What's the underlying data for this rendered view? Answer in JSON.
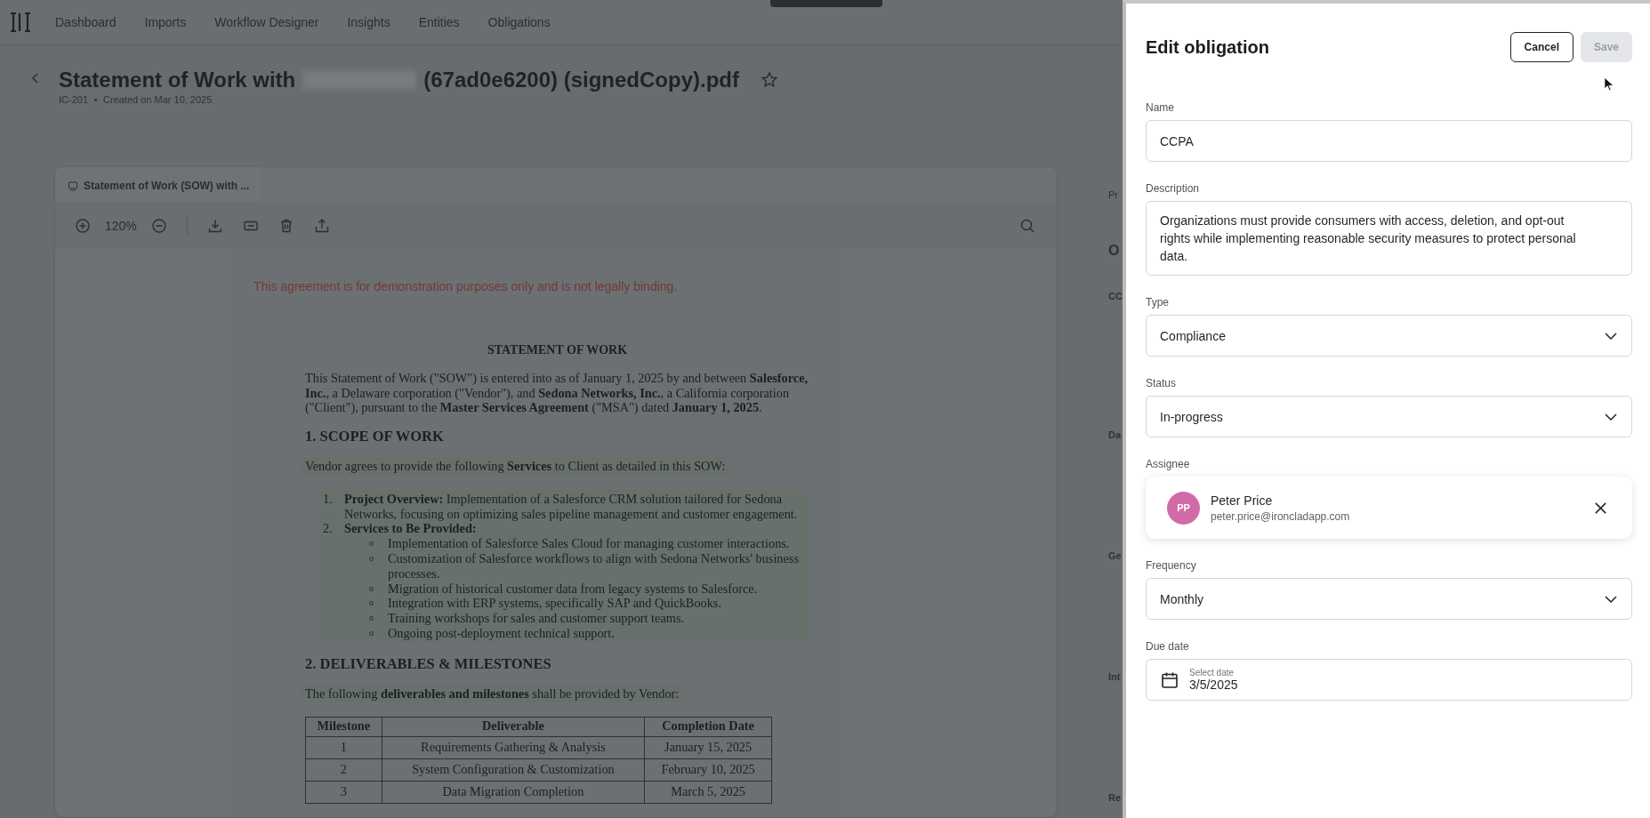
{
  "nav": {
    "items": [
      "Dashboard",
      "Imports",
      "Workflow Designer",
      "Insights",
      "Entities",
      "Obligations"
    ]
  },
  "header": {
    "title_start": "Statement of Work with",
    "title_end": "(67ad0e6200) (signedCopy).pdf",
    "starred": false,
    "meta": [
      "IC-201",
      "Created on Mar 10, 2025"
    ]
  },
  "viewer": {
    "tab": "Statement of Work (SOW) with ...",
    "zoom": "120%"
  },
  "document": {
    "disclaimer": "This agreement is for demonstration purposes only and is not legally binding.",
    "title": "STATEMENT OF WORK",
    "intro": "This Statement of Work (\"SOW\") is entered into as of January 1, 2025 by and between **Salesforce, Inc.**, a Delaware corporation (\"Vendor\"), and **Sedona Networks, Inc.**, a California corporation (\"Client\"), pursuant to the **Master Services Agreement** (\"MSA\") dated **January 1, 2025**.",
    "section1": "1. SCOPE OF WORK",
    "section1_intro": "Vendor agrees to provide the following **Services** to Client as detailed in this SOW:",
    "list": [
      {
        "number": "1.",
        "text": "**Project Overview:** Implementation of a Salesforce CRM solution tailored for Sedona Networks, focusing on optimizing sales pipeline management and customer engagement."
      },
      {
        "number": "2.",
        "text": "**Services to Be Provided:**",
        "children": [
          {
            "bullet": "o",
            "text": "Implementation of Salesforce Sales Cloud for managing customer interactions."
          },
          {
            "bullet": "o",
            "text": "Customization of Salesforce workflows to align with Sedona Networks' business processes."
          },
          {
            "bullet": "o",
            "text": "Migration of historical customer data from legacy systems to Salesforce."
          },
          {
            "bullet": "o",
            "text": "Integration with ERP systems, specifically SAP and QuickBooks."
          },
          {
            "bullet": "o",
            "text": "Training workshops for sales and customer support teams."
          },
          {
            "bullet": "o",
            "text": "Ongoing post-deployment technical support."
          }
        ]
      }
    ],
    "section2": "2. DELIVERABLES & MILESTONES",
    "section2_intro": "The following **deliverables and milestones** shall be provided by Vendor:",
    "table": {
      "columns": [
        "Milestone",
        "Deliverable",
        "Completion Date"
      ],
      "rows": [
        [
          "1",
          "Requirements Gathering & Analysis",
          "January 15, 2025"
        ],
        [
          "2",
          "System Configuration & Customization",
          "February 10, 2025"
        ],
        [
          "3",
          "Data Migration Completion",
          "March 5, 2025"
        ]
      ]
    }
  },
  "side_panel": {
    "tab": "Pr",
    "heading": "O",
    "sections": [
      "CC",
      "Da",
      "Ge",
      "Int",
      "Re"
    ]
  },
  "drawer": {
    "title": "Edit obligation",
    "buttons": [
      {
        "label": "Cancel",
        "disabled": false
      },
      {
        "label": "Save",
        "disabled": true
      }
    ],
    "fields": [
      {
        "kind": "text",
        "label": "Name",
        "value": "CCPA"
      },
      {
        "kind": "textarea",
        "label": "Description",
        "value": "Organizations must provide consumers with access, deletion, and opt-out rights while implementing reasonable security measures to protect personal data."
      },
      {
        "kind": "select",
        "label": "Type",
        "value": "Compliance"
      },
      {
        "kind": "select",
        "label": "Status",
        "value": "In-progress"
      },
      {
        "kind": "person",
        "label": "Assignee",
        "initials": "PP",
        "name": "Peter Price",
        "email": "peter.price@ironcladapp.com"
      },
      {
        "kind": "select",
        "label": "Frequency",
        "value": "Monthly"
      },
      {
        "kind": "date",
        "label": "Due date",
        "placeholder": "Select date",
        "value": "3/5/2025"
      }
    ]
  }
}
